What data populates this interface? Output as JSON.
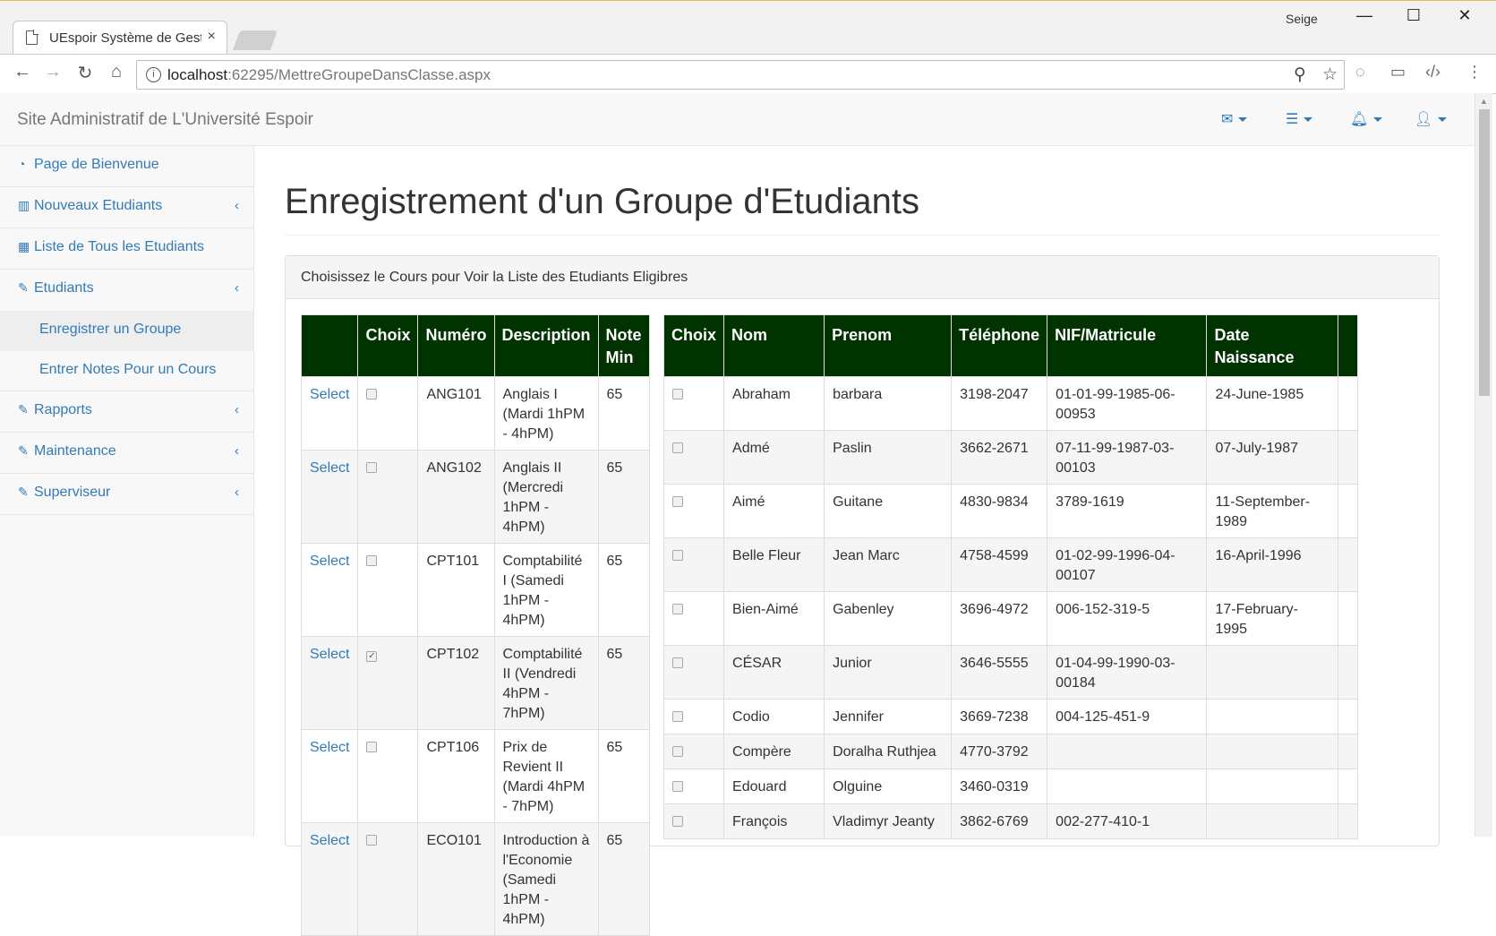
{
  "browser": {
    "tab_title": "UEspoir Système de Gesti",
    "tab_close": "×",
    "profile": "Seige",
    "url_host": "localhost",
    "url_path": ":62295/MettreGroupeDansClasse.aspx",
    "win_min": "—",
    "win_max": "☐",
    "win_close": "✕",
    "back": "←",
    "forward": "→",
    "reload": "↻",
    "home": "⌂"
  },
  "navbar": {
    "brand": "Site Administratif de L'Université Espoir",
    "icons": [
      "envelope-icon",
      "tasks-icon",
      "bell-icon",
      "user-icon"
    ]
  },
  "sidebar": {
    "items": [
      {
        "label": "Page de Bienvenue",
        "icon": "dashboard-icon",
        "glyph": "◔"
      },
      {
        "label": "Nouveaux Etudiants",
        "icon": "bar-chart-icon",
        "glyph": "▥",
        "chev": "‹"
      },
      {
        "label": "Liste de Tous les Etudiants",
        "icon": "table-icon",
        "glyph": "▦"
      },
      {
        "label": "Etudiants",
        "icon": "wrench-icon",
        "glyph": "✎",
        "chev": "‹"
      },
      {
        "label": "Rapports",
        "icon": "wrench-icon",
        "glyph": "✎",
        "chev": "‹"
      },
      {
        "label": "Maintenance",
        "icon": "wrench-icon",
        "glyph": "✎",
        "chev": "‹"
      },
      {
        "label": "Superviseur",
        "icon": "wrench-icon",
        "glyph": "✎",
        "chev": "‹"
      }
    ],
    "subitems": [
      {
        "label": "Enregistrer un Groupe"
      },
      {
        "label": "Entrer Notes Pour un Cours"
      }
    ]
  },
  "page": {
    "title": "Enregistrement d'un Groupe d'Etudiants",
    "panel_heading": "Choisissez le Cours pour Voir la Liste des Etudiants Eligibres"
  },
  "courses": {
    "headers": [
      "",
      "Choix",
      "Numéro",
      "Description",
      "Note Min"
    ],
    "select_label": "Select",
    "rows": [
      {
        "numero": "ANG101",
        "description": "Anglais I (Mardi 1hPM - 4hPM)",
        "note": "65",
        "checked": false
      },
      {
        "numero": "ANG102",
        "description": "Anglais II (Mercredi 1hPM - 4hPM)",
        "note": "65",
        "checked": false
      },
      {
        "numero": "CPT101",
        "description": "Comptabilité I (Samedi 1hPM - 4hPM)",
        "note": "65",
        "checked": false
      },
      {
        "numero": "CPT102",
        "description": "Comptabilité II (Vendredi 4hPM - 7hPM)",
        "note": "65",
        "checked": true
      },
      {
        "numero": "CPT106",
        "description": "Prix de Revient II (Mardi 4hPM - 7hPM)",
        "note": "65",
        "checked": false
      },
      {
        "numero": "ECO101",
        "description": "Introduction à l'Economie (Samedi 1hPM - 4hPM)",
        "note": "65",
        "checked": false
      }
    ]
  },
  "students": {
    "headers": [
      "Choix",
      "Nom",
      "Prenom",
      "Téléphone",
      "NIF/Matricule",
      "Date Naissance",
      ""
    ],
    "rows": [
      {
        "nom": "Abraham",
        "prenom": "barbara",
        "tel": "3198-2047",
        "nif": "01-01-99-1985-06-00953",
        "dob": "24-June-1985"
      },
      {
        "nom": "Admé",
        "prenom": "Paslin",
        "tel": "3662-2671",
        "nif": "07-11-99-1987-03-00103",
        "dob": "07-July-1987"
      },
      {
        "nom": "Aimé",
        "prenom": "Guitane",
        "tel": "4830-9834",
        "nif": "3789-1619",
        "dob": "11-September-1989"
      },
      {
        "nom": "Belle Fleur",
        "prenom": "Jean Marc",
        "tel": "4758-4599",
        "nif": "01-02-99-1996-04-00107",
        "dob": "16-April-1996"
      },
      {
        "nom": "Bien-Aimé",
        "prenom": "Gabenley",
        "tel": "3696-4972",
        "nif": "006-152-319-5",
        "dob": "17-February-1995"
      },
      {
        "nom": "CÉSAR",
        "prenom": "Junior",
        "tel": "3646-5555",
        "nif": "01-04-99-1990-03-00184",
        "dob": ""
      },
      {
        "nom": "Codio",
        "prenom": "Jennifer",
        "tel": "3669-7238",
        "nif": "004-125-451-9",
        "dob": ""
      },
      {
        "nom": "Compère",
        "prenom": "Doralha Ruthjea",
        "tel": "4770-3792",
        "nif": "",
        "dob": ""
      },
      {
        "nom": "Edouard",
        "prenom": "Olguine",
        "tel": "3460-0319",
        "nif": "",
        "dob": ""
      },
      {
        "nom": "François",
        "prenom": "Vladimyr Jeanty",
        "tel": "3862-6769",
        "nif": "002-277-410-1",
        "dob": ""
      }
    ]
  }
}
